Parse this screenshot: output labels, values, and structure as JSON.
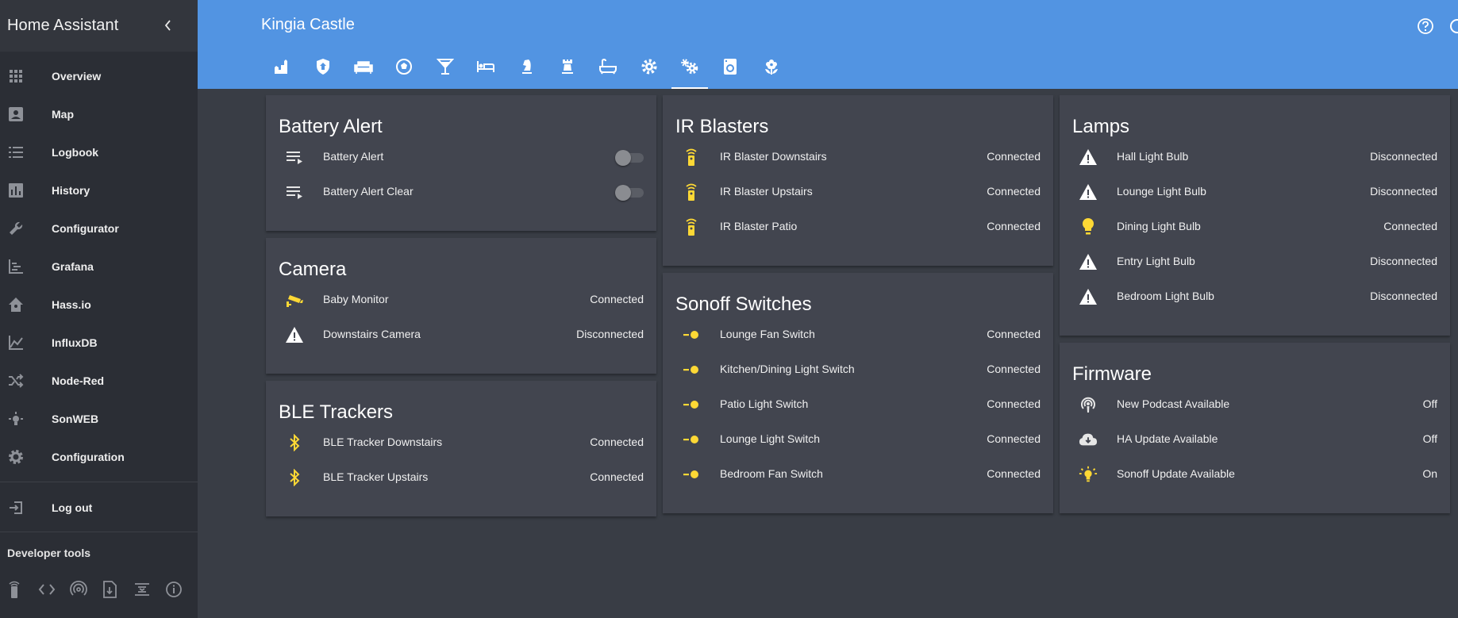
{
  "app": {
    "title": "Home Assistant"
  },
  "sidebar": {
    "items": [
      {
        "label": "Overview",
        "icon": "apps-grid-icon"
      },
      {
        "label": "Map",
        "icon": "account-box-icon"
      },
      {
        "label": "Logbook",
        "icon": "format-list-icon"
      },
      {
        "label": "History",
        "icon": "chart-bar-icon"
      },
      {
        "label": "Configurator",
        "icon": "wrench-icon"
      },
      {
        "label": "Grafana",
        "icon": "chart-timeline-icon"
      },
      {
        "label": "Hass.io",
        "icon": "home-assistant-icon"
      },
      {
        "label": "InfluxDB",
        "icon": "chart-areaspline-icon"
      },
      {
        "label": "Node-Red",
        "icon": "shuffle-icon"
      },
      {
        "label": "SonWEB",
        "icon": "lightbulb-on-icon"
      },
      {
        "label": "Configuration",
        "icon": "settings-icon"
      }
    ],
    "logout_label": "Log out",
    "developer_tools_label": "Developer tools",
    "dev_tools": [
      "remote-icon",
      "code-tags-icon",
      "access-point-icon",
      "file-download-icon",
      "file-xml-icon",
      "information-outline-icon"
    ]
  },
  "header": {
    "title": "Kingia Castle",
    "tabs": [
      "castle-icon",
      "security-icon",
      "sofa-icon",
      "soccer-icon",
      "glass-cocktail-icon",
      "bed-icon",
      "chess-knight-icon",
      "chess-rook-icon",
      "bathtub-icon",
      "settings-icon",
      "settings-multiple-icon",
      "washing-machine-icon",
      "flower-icon"
    ],
    "active_tab": 10
  },
  "colors": {
    "accent": "#5294e2",
    "icon_active": "#fdd835",
    "background": "#393d45",
    "card": "#42454f",
    "sidebar": "#2b2e35"
  },
  "cards": {
    "battery_alert": {
      "title": "Battery Alert",
      "rows": [
        {
          "name": "Battery Alert",
          "state": "off"
        },
        {
          "name": "Battery Alert Clear",
          "state": "off"
        }
      ]
    },
    "camera": {
      "title": "Camera",
      "rows": [
        {
          "name": "Baby Monitor",
          "state": "Connected",
          "icon": "cctv-icon"
        },
        {
          "name": "Downstairs Camera",
          "state": "Disconnected",
          "icon": "alert-icon"
        }
      ]
    },
    "ble": {
      "title": "BLE Trackers",
      "rows": [
        {
          "name": "BLE Tracker Downstairs",
          "state": "Connected",
          "icon": "bluetooth-icon"
        },
        {
          "name": "BLE Tracker Upstairs",
          "state": "Connected",
          "icon": "bluetooth-icon"
        }
      ]
    },
    "ir": {
      "title": "IR Blasters",
      "rows": [
        {
          "name": "IR Blaster Downstairs",
          "state": "Connected",
          "icon": "remote-icon"
        },
        {
          "name": "IR Blaster Upstairs",
          "state": "Connected",
          "icon": "remote-icon"
        },
        {
          "name": "IR Blaster Patio",
          "state": "Connected",
          "icon": "remote-icon"
        }
      ]
    },
    "sonoff": {
      "title": "Sonoff Switches",
      "rows": [
        {
          "name": "Lounge Fan Switch",
          "state": "Connected",
          "icon": "light-switch-icon"
        },
        {
          "name": "Kitchen/Dining Light Switch",
          "state": "Connected",
          "icon": "light-switch-icon"
        },
        {
          "name": "Patio Light Switch",
          "state": "Connected",
          "icon": "light-switch-icon"
        },
        {
          "name": "Lounge Light Switch",
          "state": "Connected",
          "icon": "light-switch-icon"
        },
        {
          "name": "Bedroom Fan Switch",
          "state": "Connected",
          "icon": "light-switch-icon"
        }
      ]
    },
    "lamps": {
      "title": "Lamps",
      "rows": [
        {
          "name": "Hall Light Bulb",
          "state": "Disconnected",
          "icon": "alert-icon"
        },
        {
          "name": "Lounge Light Bulb",
          "state": "Disconnected",
          "icon": "alert-icon"
        },
        {
          "name": "Dining Light Bulb",
          "state": "Connected",
          "icon": "lightbulb-icon"
        },
        {
          "name": "Entry Light Bulb",
          "state": "Disconnected",
          "icon": "alert-icon"
        },
        {
          "name": "Bedroom Light Bulb",
          "state": "Disconnected",
          "icon": "alert-icon"
        }
      ]
    },
    "firmware": {
      "title": "Firmware",
      "rows": [
        {
          "name": "New Podcast Available",
          "state": "Off",
          "icon": "podcast-icon"
        },
        {
          "name": "HA Update Available",
          "state": "Off",
          "icon": "cloud-download-icon"
        },
        {
          "name": "Sonoff Update Available",
          "state": "On",
          "icon": "lightbulb-on-icon"
        }
      ]
    }
  }
}
